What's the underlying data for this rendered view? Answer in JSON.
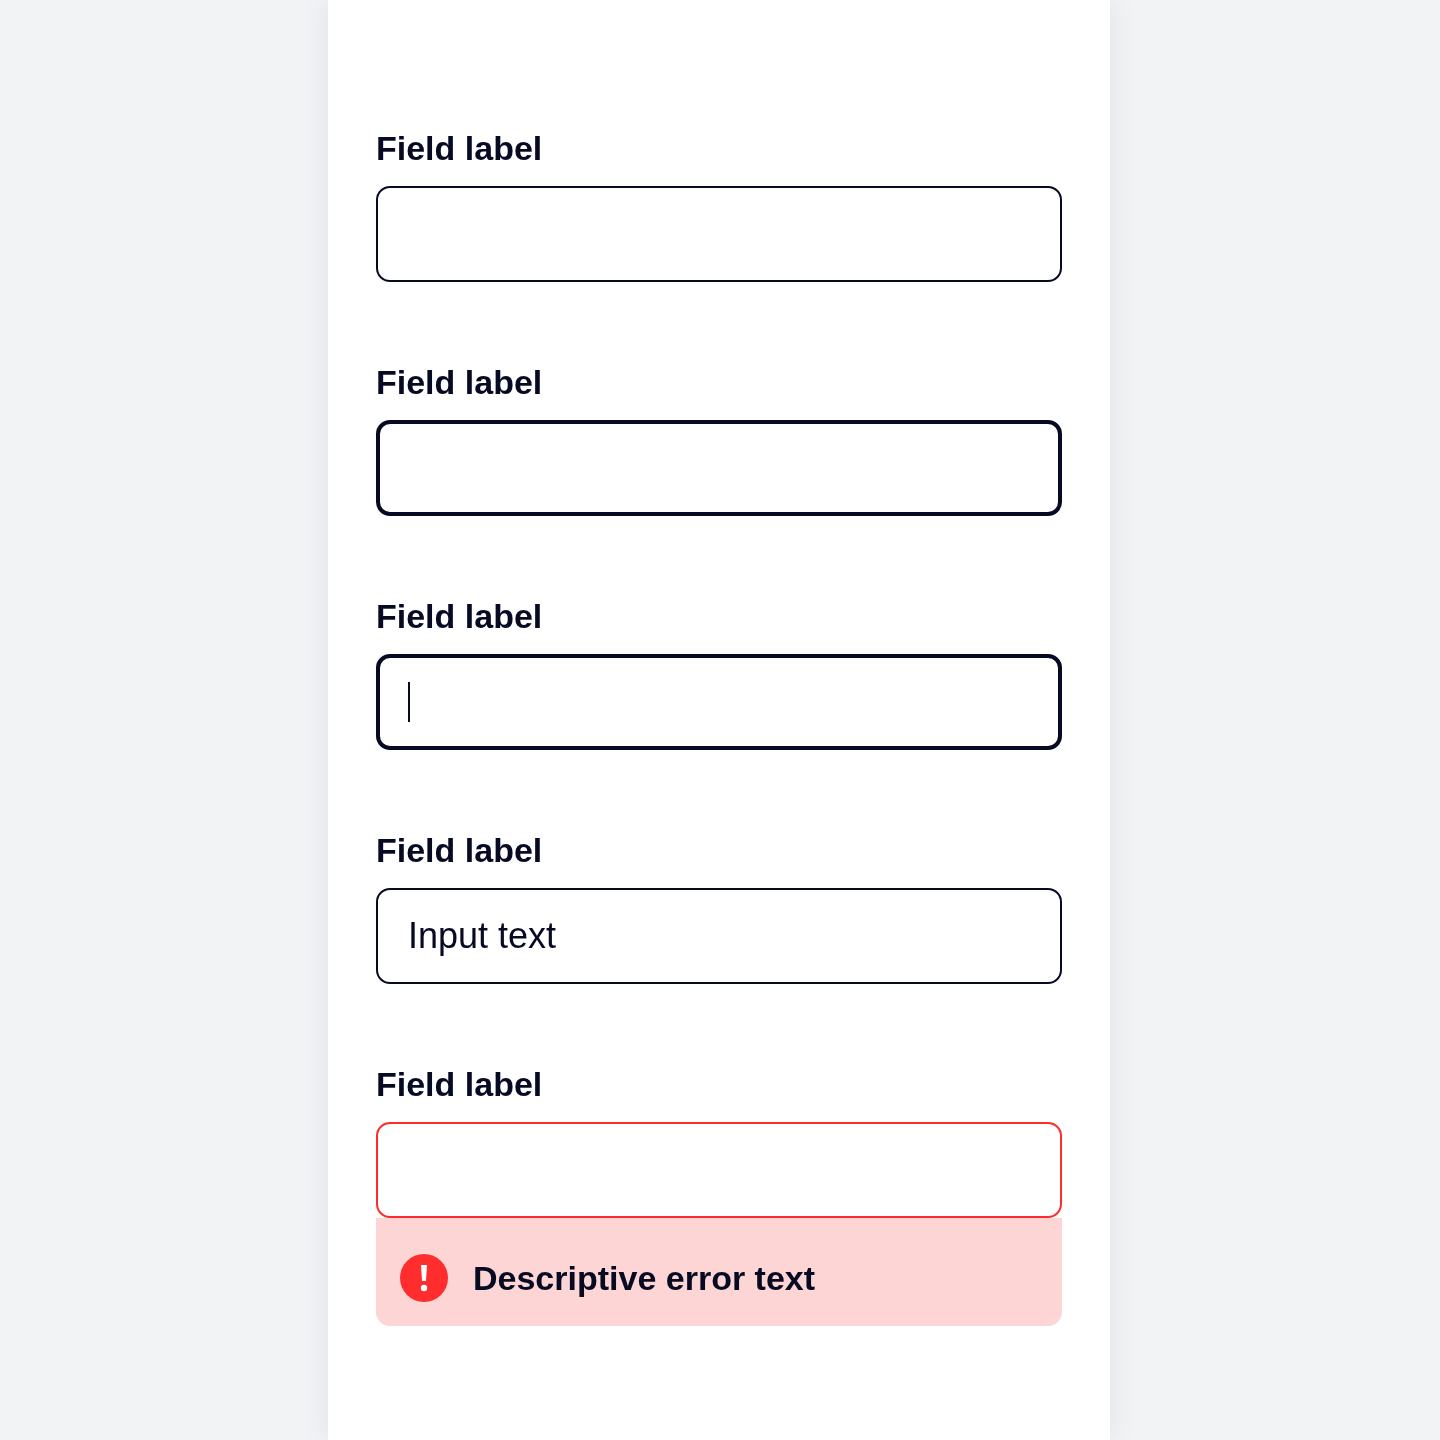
{
  "fields": [
    {
      "kind": "default",
      "label": "Field label"
    },
    {
      "kind": "hover",
      "label": "Field label"
    },
    {
      "kind": "focus",
      "label": "Field label"
    },
    {
      "kind": "default",
      "label": "Field label",
      "value": "Input text"
    },
    {
      "kind": "error",
      "label": "Field label",
      "error_text": "Descriptive error text"
    }
  ]
}
